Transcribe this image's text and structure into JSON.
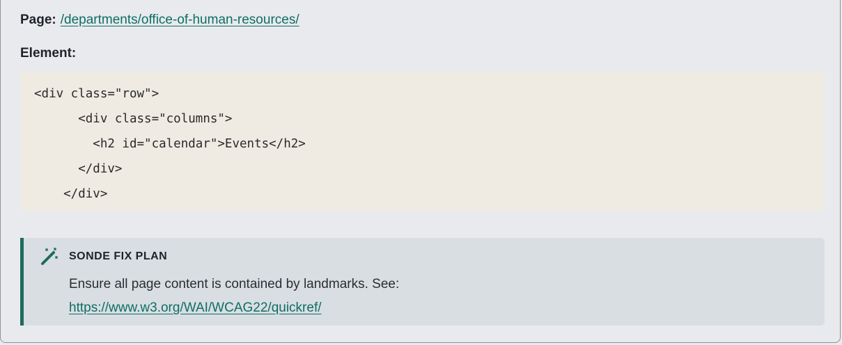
{
  "page": {
    "label": "Page:",
    "link": "/departments/office-of-human-resources/"
  },
  "element": {
    "label": "Element:"
  },
  "code": {
    "lines": [
      "<div class=\"row\">",
      "      <div class=\"columns\">",
      "        <h2 id=\"calendar\">Events</h2>",
      "      </div>",
      "    </div>"
    ]
  },
  "fix_plan": {
    "icon": "magic-wand-icon",
    "title": "SONDE FIX PLAN",
    "text": "Ensure all page content is contained by landmarks. See:",
    "link": "https://www.w3.org/WAI/WCAG22/quickref/"
  },
  "colors": {
    "accent": "#1e6b5f",
    "link": "#0d6e63",
    "code_bg": "#efebe2",
    "fix_bg": "#d9dee3",
    "panel_bg": "#e9eaee"
  }
}
